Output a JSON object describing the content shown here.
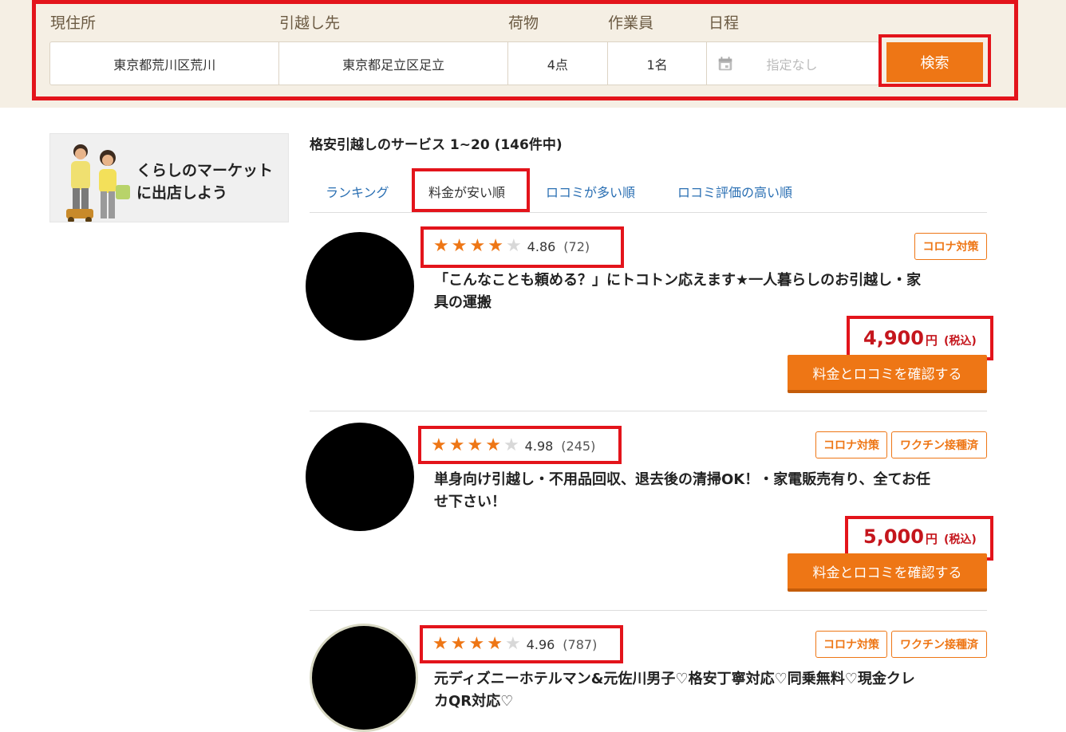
{
  "search": {
    "labels": {
      "from": "現住所",
      "to": "引越し先",
      "items": "荷物",
      "workers": "作業員",
      "date": "日程"
    },
    "values": {
      "from": "東京都荒川区荒川",
      "to": "東京都足立区足立",
      "items": "4点",
      "workers": "1名"
    },
    "date_placeholder": "指定なし",
    "button_label": "検索"
  },
  "banner": {
    "line1": "くらしのマーケット",
    "line2": "に出店しよう"
  },
  "results": {
    "title": "格安引越しのサービス 1~20 (146件中)",
    "tabs": [
      {
        "label": "ランキング",
        "active": false
      },
      {
        "label": "料金が安い順",
        "active": true
      },
      {
        "label": "ロコミが多い順",
        "active": false
      },
      {
        "label": "ロコミ評価の高い順",
        "active": false
      }
    ],
    "cards": [
      {
        "stars": 4,
        "rating": "4.86",
        "count": "(72)",
        "badges": [
          "コロナ対策"
        ],
        "title_line1": "「こんなことも頼める？」にトコトン応えます★一人暮らしのお引越し・家",
        "title_line2": "具の運搬",
        "price": "4,900",
        "price_unit": "円",
        "price_tax": "(税込)",
        "cta": "料金とロコミを確認する"
      },
      {
        "stars": 4,
        "rating": "4.98",
        "count": "(245)",
        "badges": [
          "コロナ対策",
          "ワクチン接種済"
        ],
        "title_line1": "単身向け引越し・不用品回収、退去後の清掃OK！・家電販売有り、全てお任",
        "title_line2": "せ下さい！",
        "price": "5,000",
        "price_unit": "円",
        "price_tax": "(税込)",
        "cta": "料金とロコミを確認する"
      },
      {
        "stars": 4,
        "rating": "4.96",
        "count": "(787)",
        "badges": [
          "コロナ対策",
          "ワクチン接種済"
        ],
        "title_line1": "元ディズニーホテルマン&元佐川男子♡格安丁寧対応♡同乗無料♡現金クレ",
        "title_line2": "カQR対応♡"
      }
    ]
  },
  "colors": {
    "accent": "#ee7615",
    "price": "#c5161d",
    "highlight": "#e3141b",
    "link": "#2a6fb3",
    "band": "#f5efe4"
  }
}
